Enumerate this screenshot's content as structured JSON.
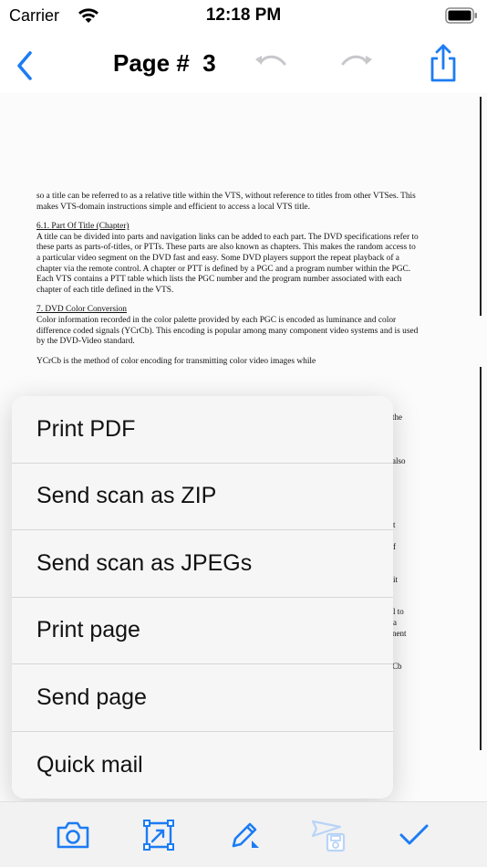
{
  "status_bar": {
    "carrier": "Carrier",
    "time": "12:18 PM"
  },
  "nav": {
    "title": "Page #  3",
    "accent_color": "#1c7cf4",
    "disabled_color": "#c7c7cc"
  },
  "document": {
    "paragraphs": [
      "so a title can be referred to as a relative title within the VTS, without reference to titles from other VTSes. This makes VTS-domain instructions simple and efficient to access a local VTS title.",
      "A title can be divided into parts and navigation links can be added to each part. The DVD specifications refer to these parts as parts-of-titles, or PTTs. These parts are also known as chapters. This makes the random access to a particular video segment on the DVD fast and easy. Some DVD players support the repeat playback of a chapter via the remote control. A chapter or PTT is defined by a PGC and a program number within the PGC. Each VTS contains a PTT table which lists the PGC number and the program number associated with each chapter of each title defined in the VTS.",
      "Color information recorded in the color palette provided by each PGC is encoded as luminance and color difference coded signals (YCrCb). This encoding is popular among many component video systems and is used by the DVD-Video standard.",
      "YCrCb is the method of color encoding for transmitting color video images while"
    ],
    "headings": [
      "6.1. Part Of Title (Chapter)",
      "7. DVD Color Conversion"
    ],
    "fragments": [
      "the",
      "also",
      "t",
      "f",
      "it",
      "l to",
      "a",
      "nent",
      "Cb"
    ]
  },
  "menu": {
    "items": [
      "Print PDF",
      "Send scan as ZIP",
      "Send scan as JPEGs",
      "Print page",
      "Send page",
      "Quick mail"
    ]
  },
  "toolbar": {
    "icons": [
      "camera-icon",
      "crop-icon",
      "pencil-icon",
      "send-save-icon",
      "checkmark-icon"
    ]
  }
}
